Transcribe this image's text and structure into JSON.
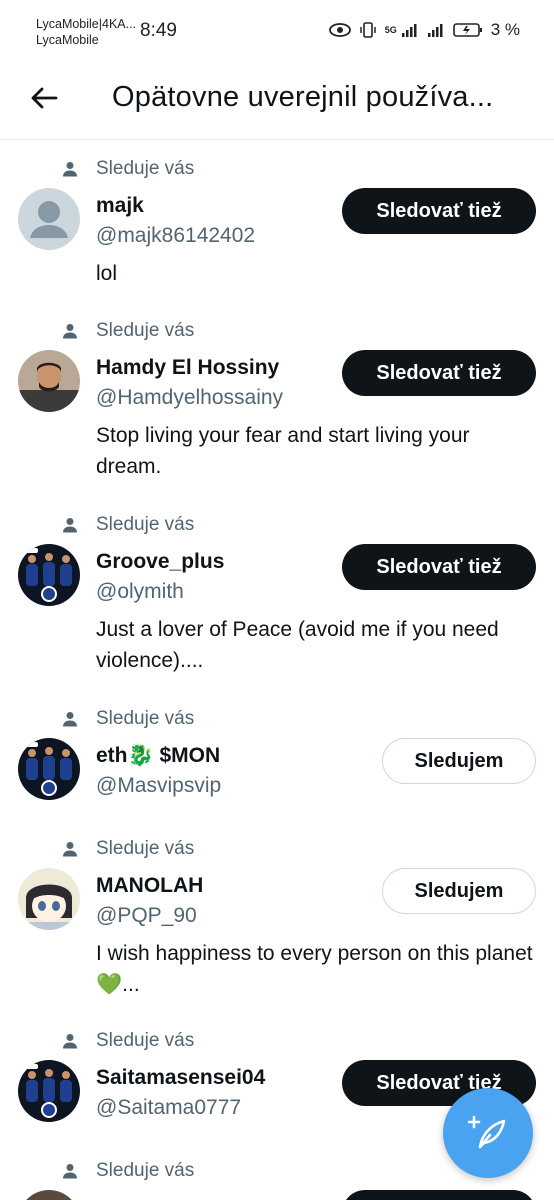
{
  "status_bar": {
    "carrier_line1": "LycaMobile|4KA...",
    "carrier_line2": "LycaMobile",
    "time": "8:49",
    "network": "5G",
    "battery": "3 %"
  },
  "header": {
    "title": "Opätovne uverejnil používa..."
  },
  "users": [
    {
      "follows_you": "Sleduje vás",
      "name": "majk",
      "handle": "@majk86142402",
      "bio": "lol",
      "button": "Sledovať tiež",
      "button_style": "dark",
      "avatar": "default"
    },
    {
      "follows_you": "Sleduje vás",
      "name": "Hamdy El Hossiny",
      "handle": "@Hamdyelhossainy",
      "bio": "Stop living your fear and start living your dream.",
      "button": "Sledovať tiež",
      "button_style": "dark",
      "avatar": "photo"
    },
    {
      "follows_you": "Sleduje vás",
      "name": "Groove_plus",
      "handle": "@olymith",
      "bio": "Just a lover of Peace (avoid me if you need violence)....",
      "button": "Sledovať tiež",
      "button_style": "dark",
      "avatar": "team"
    },
    {
      "follows_you": "Sleduje vás",
      "name": "eth🐉 $MON",
      "handle": "@Masvipsvip",
      "bio": "",
      "button": "Sledujem",
      "button_style": "light",
      "avatar": "team"
    },
    {
      "follows_you": "Sleduje vás",
      "name": "MANOLAH",
      "handle": "@PQP_90",
      "bio": "I wish happiness to every person on this planet💚...",
      "button": "Sledujem",
      "button_style": "light",
      "avatar": "anime"
    },
    {
      "follows_you": "Sleduje vás",
      "name": "Saitamasensei04",
      "handle": "@Saitama0777",
      "bio": "",
      "button": "Sledovať tiež",
      "button_style": "dark",
      "avatar": "team"
    },
    {
      "follows_you": "Sleduje vás",
      "name": "",
      "handle": "",
      "bio": "",
      "button": "",
      "button_style": "dark",
      "avatar": "dark"
    }
  ],
  "colors": {
    "primary_text": "#0f1419",
    "secondary_text": "#536471",
    "button_dark": "#0f1419",
    "fab_blue": "#4aa3f0"
  },
  "icons": [
    "back-arrow-icon",
    "person-icon",
    "compose-post-icon"
  ]
}
